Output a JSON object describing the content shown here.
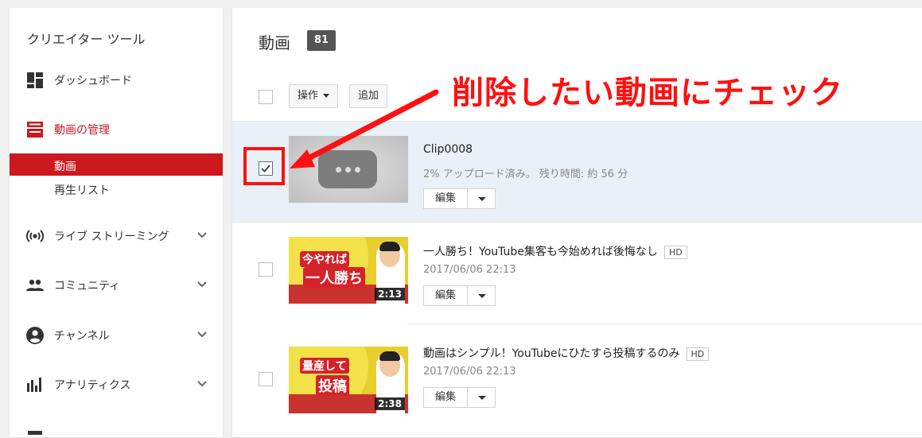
{
  "sidebar": {
    "title": "クリエイター ツール",
    "items": {
      "dashboard": "ダッシュボード",
      "video_manager": "動画の管理",
      "videos": "動画",
      "playlists": "再生リスト",
      "live": "ライブ ストリーミング",
      "community": "コミュニティ",
      "channel": "チャンネル",
      "analytics": "アナリティクス"
    }
  },
  "main": {
    "title": "動画",
    "count": "81",
    "actions_label": "操作",
    "add_label": "追加",
    "edit_label": "編集",
    "videos": [
      {
        "title": "Clip0008",
        "status": "2% アップロード済み。 残り時間: 約 56 分",
        "checked": true
      },
      {
        "title": "一人勝ち！YouTube集客も今始めれば後悔なし",
        "hd": "HD",
        "date": "2017/06/06 22:13",
        "duration": "2:13",
        "thumb_top": "今やれば",
        "thumb_bottom": "一人勝ち"
      },
      {
        "title": "動画はシンプル！YouTubeにひたすら投稿するのみ",
        "hd": "HD",
        "date": "2017/06/06 22:13",
        "duration": "2:38",
        "thumb_top": "量産して",
        "thumb_bottom": "投稿"
      }
    ]
  },
  "annotation": "削除したい動画にチェック",
  "colors": {
    "accent": "#cc181e",
    "annotation": "#ff1010",
    "selected_row": "#e9f0f8"
  }
}
